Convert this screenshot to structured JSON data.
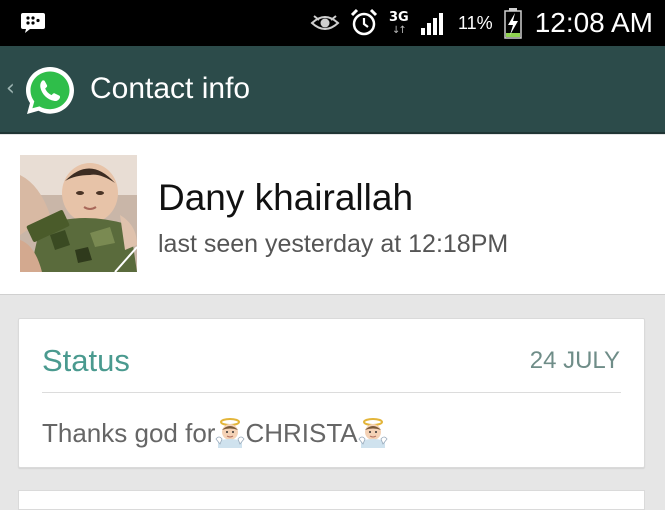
{
  "status_bar": {
    "network": "3G",
    "battery_percent": "11%",
    "time": "12:08 AM",
    "icons": [
      "bbm-icon",
      "eye-icon",
      "alarm-icon",
      "network-3g-icon",
      "signal-icon",
      "battery-charging-icon"
    ]
  },
  "action_bar": {
    "title": "Contact info",
    "icons": [
      "back-chevron-icon",
      "whatsapp-logo-icon"
    ]
  },
  "profile": {
    "name": "Dany khairallah",
    "last_seen": "last seen yesterday at 12:18PM"
  },
  "status": {
    "title": "Status",
    "date": "24 JULY",
    "text_before": "Thanks god for",
    "text_name": "CHRISTA",
    "emoji": "baby-angel-emoji"
  },
  "colors": {
    "action_bar": "#2c4b4a",
    "status_accent": "#4a9a8f",
    "whatsapp_green": "#2fbe4a",
    "background": "#e6e6e6"
  }
}
